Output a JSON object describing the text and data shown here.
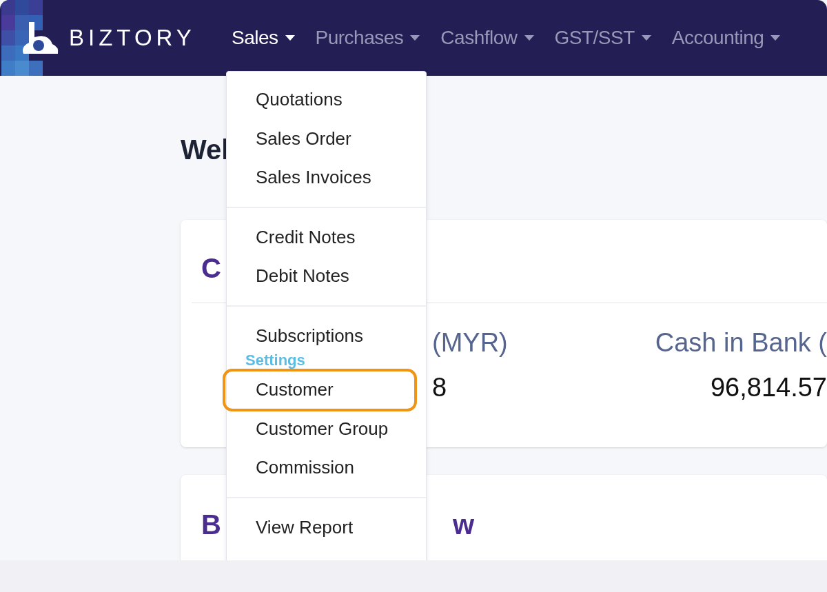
{
  "brand": {
    "name": "BIZTORY"
  },
  "nav": {
    "items": [
      {
        "label": "Sales",
        "selected": true
      },
      {
        "label": "Purchases",
        "selected": false
      },
      {
        "label": "Cashflow",
        "selected": false
      },
      {
        "label": "GST/SST",
        "selected": false
      },
      {
        "label": "Accounting",
        "selected": false
      }
    ]
  },
  "page": {
    "heading": "Wel",
    "cards": [
      {
        "title": "C",
        "stats": [
          {
            "label": "(MYR)",
            "value": "8"
          },
          {
            "label": "Cash in Bank (",
            "value": "96,814.57"
          }
        ]
      },
      {
        "title": "B",
        "title_end": "w"
      }
    ]
  },
  "dropdown": {
    "groups": [
      {
        "items": [
          {
            "kind": "item",
            "label": "Quotations",
            "highlighted": false
          },
          {
            "kind": "item",
            "label": "Sales Order",
            "highlighted": false
          },
          {
            "kind": "item",
            "label": "Sales Invoices",
            "highlighted": false
          }
        ]
      },
      {
        "items": [
          {
            "kind": "item",
            "label": "Credit Notes",
            "highlighted": false
          },
          {
            "kind": "item",
            "label": "Debit Notes",
            "highlighted": false
          }
        ]
      },
      {
        "items": [
          {
            "kind": "item",
            "label": "Subscriptions",
            "highlighted": false
          },
          {
            "kind": "heading",
            "label": "Settings"
          },
          {
            "kind": "item",
            "label": "Customer",
            "highlighted": true
          },
          {
            "kind": "item",
            "label": "Customer Group",
            "highlighted": false
          },
          {
            "kind": "item",
            "label": "Commission",
            "highlighted": false
          }
        ]
      },
      {
        "items": [
          {
            "kind": "item",
            "label": "View Report",
            "highlighted": false
          }
        ]
      }
    ]
  }
}
